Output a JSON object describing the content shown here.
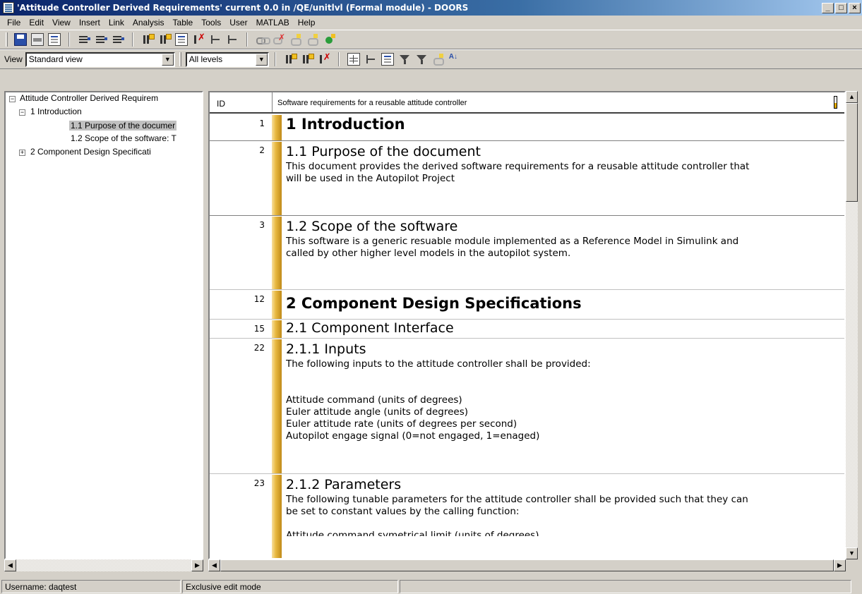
{
  "window": {
    "title": "'Attitude Controller Derived Requirements' current 0.0 in /QE/unitlvl (Formal module) - DOORS",
    "buttons": [
      "_",
      "□",
      "×"
    ]
  },
  "menu": [
    "File",
    "Edit",
    "View",
    "Insert",
    "Link",
    "Analysis",
    "Table",
    "Tools",
    "User",
    "MATLAB",
    "Help"
  ],
  "toolbar2": {
    "view_label": "View",
    "view_value": "Standard view",
    "levels_value": "All levels"
  },
  "tree": {
    "root": "Attitude Controller Derived Requirem",
    "items": [
      {
        "label": "1 Introduction"
      },
      {
        "label": "1.1 Purpose of the documer"
      },
      {
        "label": "1.2 Scope of the software: T"
      },
      {
        "label": "2 Component Design Specificati"
      }
    ]
  },
  "columns": {
    "id": "ID",
    "main": "Software requirements for a reusable attitude controller"
  },
  "rows": [
    {
      "id": "1",
      "heading": "1 Introduction",
      "lines": []
    },
    {
      "id": "2",
      "heading": "1.1 Purpose of the document",
      "lines": [
        "This document provides the derived software requirements for a reusable attitude controller that",
        "will be used in the Autopilot Project"
      ]
    },
    {
      "id": "3",
      "heading": "1.2 Scope of the software",
      "lines": [
        "This software is a generic resuable module implemented as a Reference Model in Simulink and",
        "called by other higher level models in the autopilot system."
      ]
    },
    {
      "id": "12",
      "heading": "2 Component Design Specifications",
      "lines": []
    },
    {
      "id": "15",
      "heading": "2.1 Component Interface",
      "lines": []
    },
    {
      "id": "22",
      "heading": "2.1.1 Inputs",
      "lines": [
        "The following inputs to the attitude controller shall be provided:",
        "",
        "Attitude command (units of degrees)",
        "Euler attitude angle (units of degrees)",
        "Euler attitude rate (units of degrees per second)",
        "Autopilot engage signal (0=not engaged, 1=enaged)"
      ]
    },
    {
      "id": "23",
      "heading": "2.1.2 Parameters",
      "lines": [
        "The following tunable parameters for the attitude controller shall be provided such that they can",
        "be set to constant values by the calling function:",
        "",
        "Attitude command symetrical limit (units of degrees)"
      ]
    }
  ],
  "status": {
    "user": "Username: daqtest",
    "mode": "Exclusive edit mode"
  }
}
